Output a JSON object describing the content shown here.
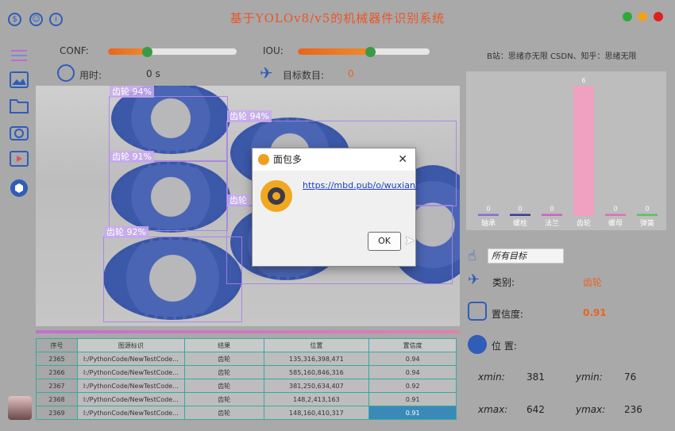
{
  "window": {
    "title": "基于YOLOv8/v5的机械器件识别系统",
    "controls": [
      {
        "name": "minimize",
        "color": "#2eaa3a"
      },
      {
        "name": "maximize",
        "color": "#f2a020"
      },
      {
        "name": "close",
        "color": "#e02020"
      }
    ]
  },
  "top_icons": [
    "piggy-bank-icon",
    "user-icon",
    "info-icon"
  ],
  "toolbar": {
    "conf_label": "CONF:",
    "conf_value": 0.3,
    "iou_label": "IOU:",
    "iou_value": 0.55,
    "time_label": "用时:",
    "time_value": "0 s",
    "count_label": "目标数目:",
    "count_value": "0"
  },
  "credits": "B站：思绪亦无限  CSDN、知乎：思绪无限",
  "sidebar": [
    "menu-icon",
    "image-icon",
    "folder-icon",
    "camera-icon",
    "video-icon",
    "model-icon"
  ],
  "detections": [
    {
      "label": "齿轮 94%"
    },
    {
      "label": "齿轮 94%"
    },
    {
      "label": "齿轮 91%"
    },
    {
      "label": "齿轮"
    },
    {
      "label": "齿轮 92%"
    }
  ],
  "dialog": {
    "title": "面包多",
    "link": "https://mbd.pub/o/wuxian/",
    "ok": "OK"
  },
  "table": {
    "headers": [
      "序号",
      "图源标识",
      "结果",
      "位置",
      "置信度"
    ],
    "rows": [
      [
        "2365",
        "I:/PythonCode/NewTestCode...",
        "齿轮",
        "135,316,398,471",
        "0.94"
      ],
      [
        "2366",
        "I:/PythonCode/NewTestCode...",
        "齿轮",
        "585,160,846,316",
        "0.94"
      ],
      [
        "2367",
        "I:/PythonCode/NewTestCode...",
        "齿轮",
        "381,250,634,407",
        "0.92"
      ],
      [
        "2368",
        "I:/PythonCode/NewTestCode...",
        "齿轮",
        "148,2,413,163",
        "0.91"
      ],
      [
        "2369",
        "I:/PythonCode/NewTestCode...",
        "齿轮",
        "148,160,410,317",
        "0.91"
      ]
    ]
  },
  "chart_data": {
    "type": "bar",
    "categories": [
      "轴承",
      "螺栓",
      "法兰",
      "齿轮",
      "螺母",
      "弹簧"
    ],
    "values": [
      0,
      0,
      0,
      6,
      0,
      0
    ],
    "colors": [
      "#8a6ad0",
      "#3a3a9a",
      "#d060c0",
      "#f0a0c0",
      "#e070b0",
      "#60c060"
    ],
    "ylim": [
      0,
      6
    ]
  },
  "target_select": {
    "value": "所有目标"
  },
  "info": {
    "class_label": "类别:",
    "class_value": "齿轮",
    "conf_label": "置信度:",
    "conf_value": "0.91",
    "pos_label": "位 置:",
    "xmin_label": "xmin:",
    "xmin": "381",
    "ymin_label": "ymin:",
    "ymin": "76",
    "xmax_label": "xmax:",
    "xmax": "642",
    "ymax_label": "ymax:",
    "ymax": "236"
  }
}
